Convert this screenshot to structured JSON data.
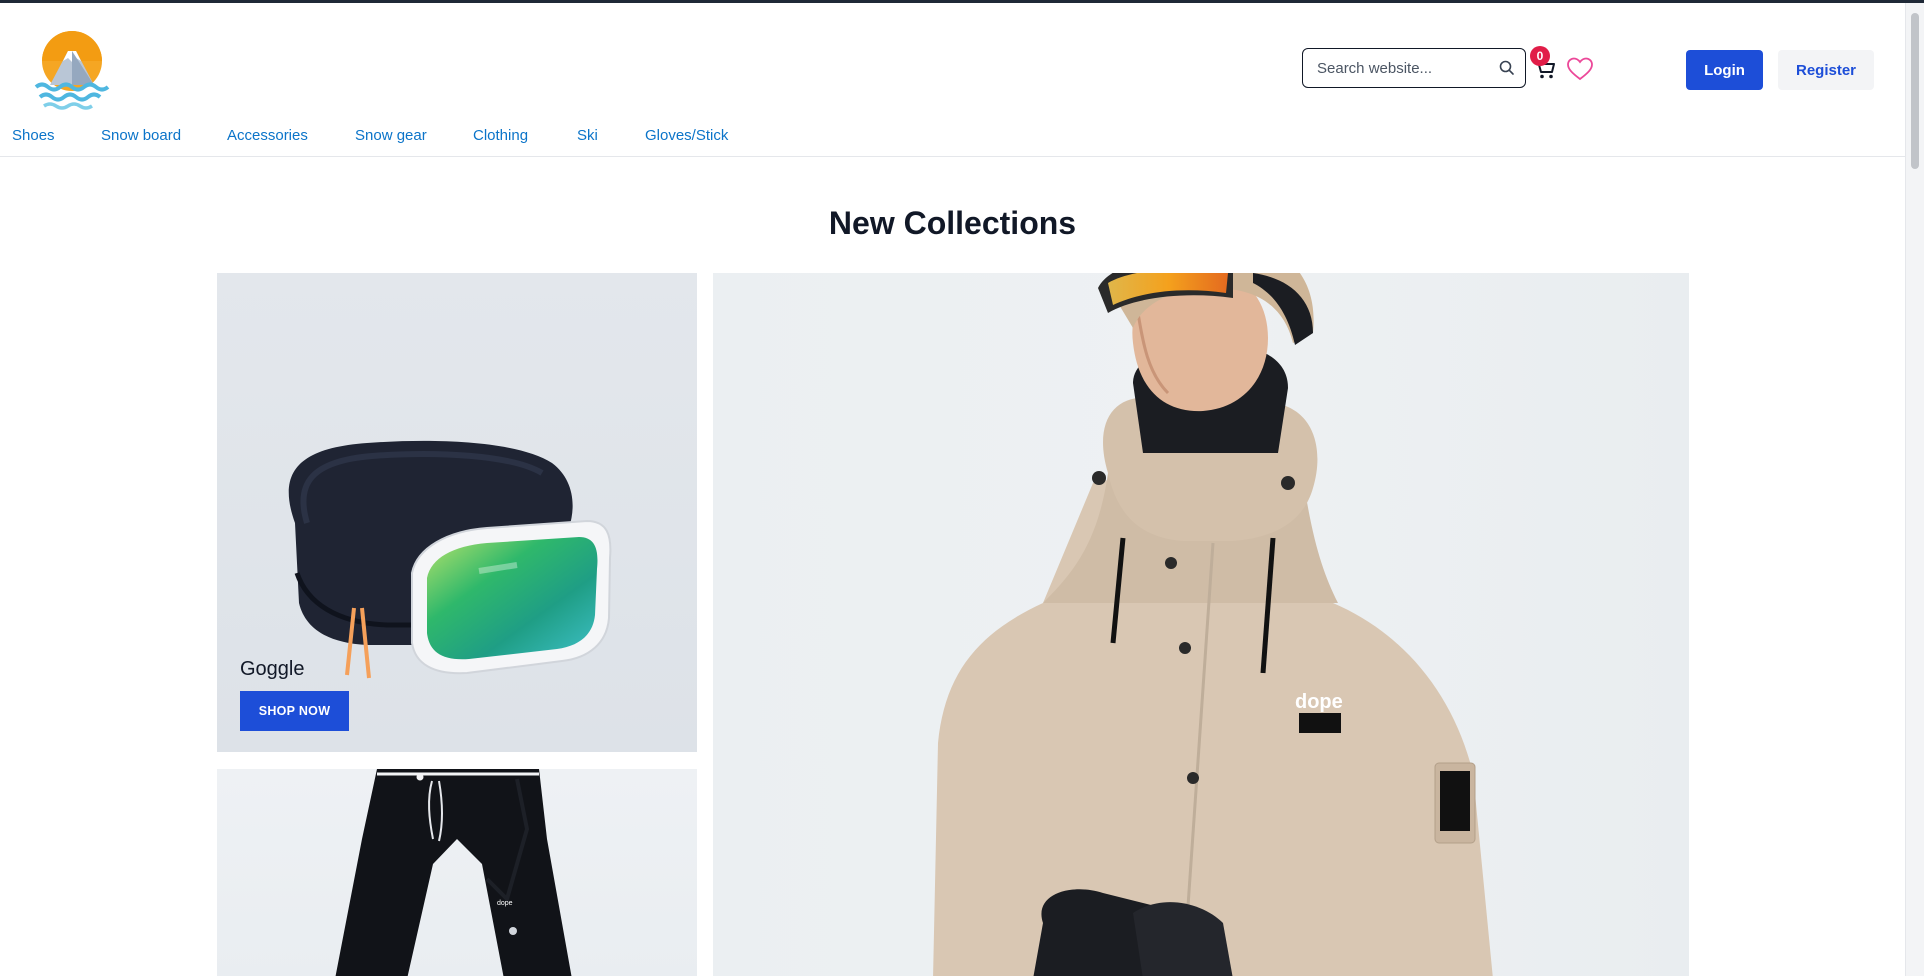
{
  "header": {
    "logo_alt": "logo",
    "search": {
      "placeholder": "Search website..."
    },
    "cart": {
      "count": "0"
    },
    "login_label": "Login",
    "register_label": "Register"
  },
  "nav": {
    "items": [
      {
        "label": "Shoes"
      },
      {
        "label": "Snow board"
      },
      {
        "label": "Accessories"
      },
      {
        "label": "Snow gear"
      },
      {
        "label": "Clothing"
      },
      {
        "label": "Ski"
      },
      {
        "label": "Gloves/Stick"
      }
    ]
  },
  "main": {
    "title": "New Collections",
    "tiles": [
      {
        "name": "Goggle",
        "button": "SHOP NOW"
      }
    ]
  },
  "colors": {
    "accent": "#1d4ed8",
    "nav_link": "#0b74c9",
    "badge": "#e11d48",
    "heart": "#ec4899"
  },
  "icons": [
    "logo-mountain-icon",
    "search-icon",
    "cart-icon",
    "heart-icon"
  ]
}
